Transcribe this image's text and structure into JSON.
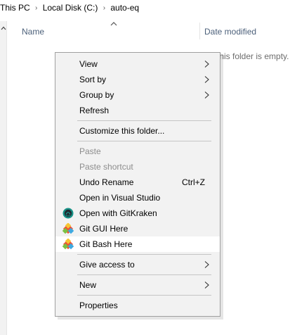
{
  "breadcrumb": {
    "items": [
      "This PC",
      "Local Disk (C:)",
      "auto-eq"
    ],
    "separator": "›"
  },
  "columns": {
    "name": "Name",
    "date_modified": "Date modified"
  },
  "empty_message": "This folder is empty.",
  "context_menu": {
    "view": "View",
    "sort_by": "Sort by",
    "group_by": "Group by",
    "refresh": "Refresh",
    "customize": "Customize this folder...",
    "paste": "Paste",
    "paste_shortcut": "Paste shortcut",
    "undo_rename": "Undo Rename",
    "undo_rename_shortcut": "Ctrl+Z",
    "open_visual_studio": "Open in Visual Studio",
    "open_gitkraken": "Open with GitKraken",
    "git_gui": "Git GUI Here",
    "git_bash": "Git Bash Here",
    "give_access": "Give access to",
    "new": "New",
    "properties": "Properties"
  },
  "colors": {
    "menu_bg": "#f2f2f2",
    "header_text": "#4c607a",
    "disabled_text": "#8d8d8d",
    "gitkraken_teal": "#179287",
    "git_orange": "#f05033"
  }
}
